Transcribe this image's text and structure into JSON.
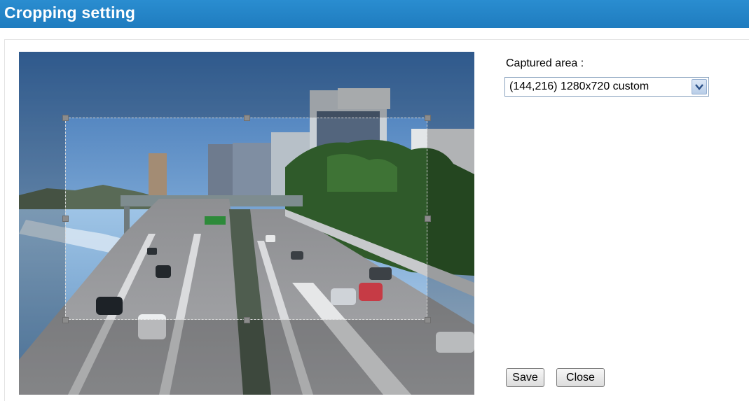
{
  "header": {
    "title": "Cropping setting"
  },
  "capture": {
    "label": "Captured area :",
    "selected_option": "(144,216) 1280x720 custom"
  },
  "actions": {
    "save_label": "Save",
    "close_label": "Close"
  },
  "icons": {
    "dropdown": "chevron-down-icon"
  },
  "colors": {
    "title_bar": "#2a8dd0",
    "title_text": "#ffffff"
  }
}
